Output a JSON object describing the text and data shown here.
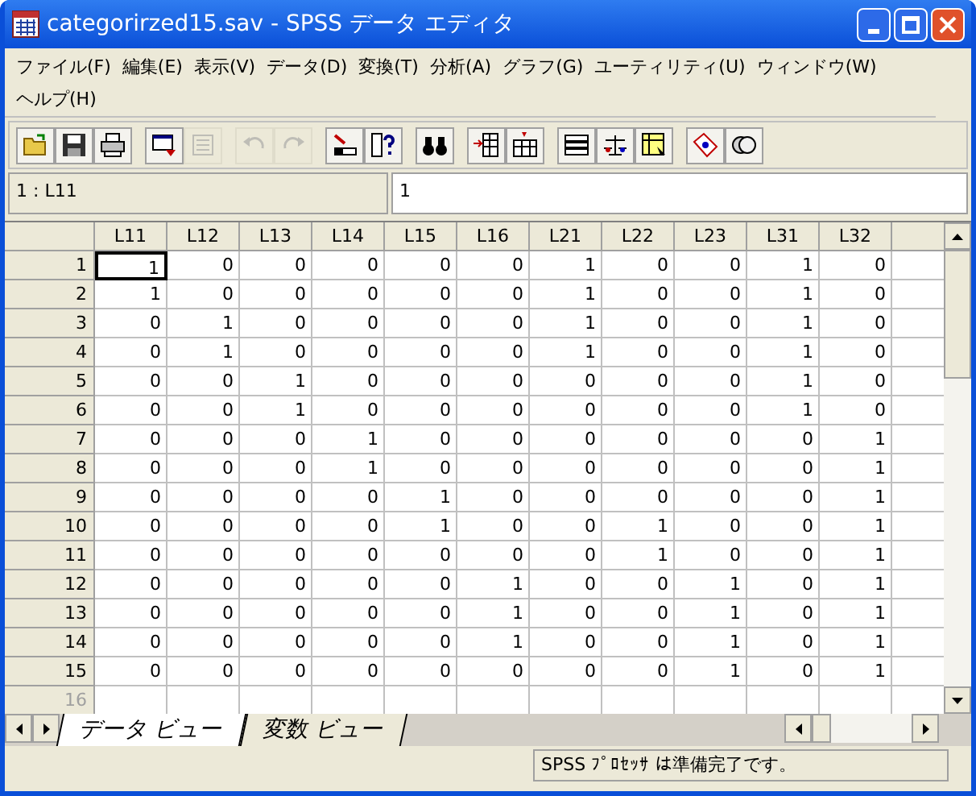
{
  "window": {
    "title": "categorirzed15.sav - SPSS データ エディタ"
  },
  "menu": [
    "ファイル(F)",
    "編集(E)",
    "表示(V)",
    "データ(D)",
    "変換(T)",
    "分析(A)",
    "グラフ(G)",
    "ユーティリティ(U)",
    "ウィンドウ(W)",
    "ヘルプ(H)"
  ],
  "toolbar": [
    {
      "kind": "open",
      "disabled": false
    },
    {
      "kind": "save",
      "disabled": false
    },
    {
      "kind": "print",
      "disabled": false
    },
    {
      "kind": "sep"
    },
    {
      "kind": "dialog",
      "disabled": false
    },
    {
      "kind": "sheet",
      "disabled": true
    },
    {
      "kind": "sep"
    },
    {
      "kind": "undo",
      "disabled": true
    },
    {
      "kind": "redo",
      "disabled": true
    },
    {
      "kind": "sep"
    },
    {
      "kind": "goto",
      "disabled": false
    },
    {
      "kind": "help",
      "disabled": false
    },
    {
      "kind": "sep"
    },
    {
      "kind": "find",
      "disabled": false
    },
    {
      "kind": "sep"
    },
    {
      "kind": "insert-row",
      "disabled": false
    },
    {
      "kind": "insert-col",
      "disabled": false
    },
    {
      "kind": "sep"
    },
    {
      "kind": "split",
      "disabled": false
    },
    {
      "kind": "weight",
      "disabled": false
    },
    {
      "kind": "select",
      "disabled": false
    },
    {
      "kind": "sep"
    },
    {
      "kind": "label",
      "disabled": false
    },
    {
      "kind": "sets",
      "disabled": false
    }
  ],
  "cell_editor": {
    "cell": "1 : L11",
    "value": "1"
  },
  "columns": [
    "L11",
    "L12",
    "L13",
    "L14",
    "L15",
    "L16",
    "L21",
    "L22",
    "L23",
    "L31",
    "L32"
  ],
  "rows": [
    {
      "label": "1",
      "selected": true,
      "disabled": false,
      "cells": [
        "1",
        "0",
        "0",
        "0",
        "0",
        "0",
        "1",
        "0",
        "0",
        "1",
        "0"
      ]
    },
    {
      "label": "2",
      "selected": false,
      "disabled": false,
      "cells": [
        "1",
        "0",
        "0",
        "0",
        "0",
        "0",
        "1",
        "0",
        "0",
        "1",
        "0"
      ]
    },
    {
      "label": "3",
      "selected": false,
      "disabled": false,
      "cells": [
        "0",
        "1",
        "0",
        "0",
        "0",
        "0",
        "1",
        "0",
        "0",
        "1",
        "0"
      ]
    },
    {
      "label": "4",
      "selected": false,
      "disabled": false,
      "cells": [
        "0",
        "1",
        "0",
        "0",
        "0",
        "0",
        "1",
        "0",
        "0",
        "1",
        "0"
      ]
    },
    {
      "label": "5",
      "selected": false,
      "disabled": false,
      "cells": [
        "0",
        "0",
        "1",
        "0",
        "0",
        "0",
        "0",
        "0",
        "0",
        "1",
        "0"
      ]
    },
    {
      "label": "6",
      "selected": false,
      "disabled": false,
      "cells": [
        "0",
        "0",
        "1",
        "0",
        "0",
        "0",
        "0",
        "0",
        "0",
        "1",
        "0"
      ]
    },
    {
      "label": "7",
      "selected": false,
      "disabled": false,
      "cells": [
        "0",
        "0",
        "0",
        "1",
        "0",
        "0",
        "0",
        "0",
        "0",
        "0",
        "1"
      ]
    },
    {
      "label": "8",
      "selected": false,
      "disabled": false,
      "cells": [
        "0",
        "0",
        "0",
        "1",
        "0",
        "0",
        "0",
        "0",
        "0",
        "0",
        "1"
      ]
    },
    {
      "label": "9",
      "selected": false,
      "disabled": false,
      "cells": [
        "0",
        "0",
        "0",
        "0",
        "1",
        "0",
        "0",
        "0",
        "0",
        "0",
        "1"
      ]
    },
    {
      "label": "10",
      "selected": false,
      "disabled": false,
      "cells": [
        "0",
        "0",
        "0",
        "0",
        "1",
        "0",
        "0",
        "1",
        "0",
        "0",
        "1"
      ]
    },
    {
      "label": "11",
      "selected": false,
      "disabled": false,
      "cells": [
        "0",
        "0",
        "0",
        "0",
        "0",
        "0",
        "0",
        "1",
        "0",
        "0",
        "1"
      ]
    },
    {
      "label": "12",
      "selected": false,
      "disabled": false,
      "cells": [
        "0",
        "0",
        "0",
        "0",
        "0",
        "1",
        "0",
        "0",
        "1",
        "0",
        "1"
      ]
    },
    {
      "label": "13",
      "selected": false,
      "disabled": false,
      "cells": [
        "0",
        "0",
        "0",
        "0",
        "0",
        "1",
        "0",
        "0",
        "1",
        "0",
        "1"
      ]
    },
    {
      "label": "14",
      "selected": false,
      "disabled": false,
      "cells": [
        "0",
        "0",
        "0",
        "0",
        "0",
        "1",
        "0",
        "0",
        "1",
        "0",
        "1"
      ]
    },
    {
      "label": "15",
      "selected": false,
      "disabled": false,
      "cells": [
        "0",
        "0",
        "0",
        "0",
        "0",
        "0",
        "0",
        "0",
        "1",
        "0",
        "1"
      ]
    },
    {
      "label": "16",
      "selected": false,
      "disabled": true
    }
  ],
  "tabs": [
    {
      "label": "データ ビュー",
      "selected": true
    },
    {
      "label": "変数 ビュー",
      "selected": false
    }
  ],
  "status_bar": "SPSS ﾌﾟﾛｾｯｻ は準備完了です。"
}
